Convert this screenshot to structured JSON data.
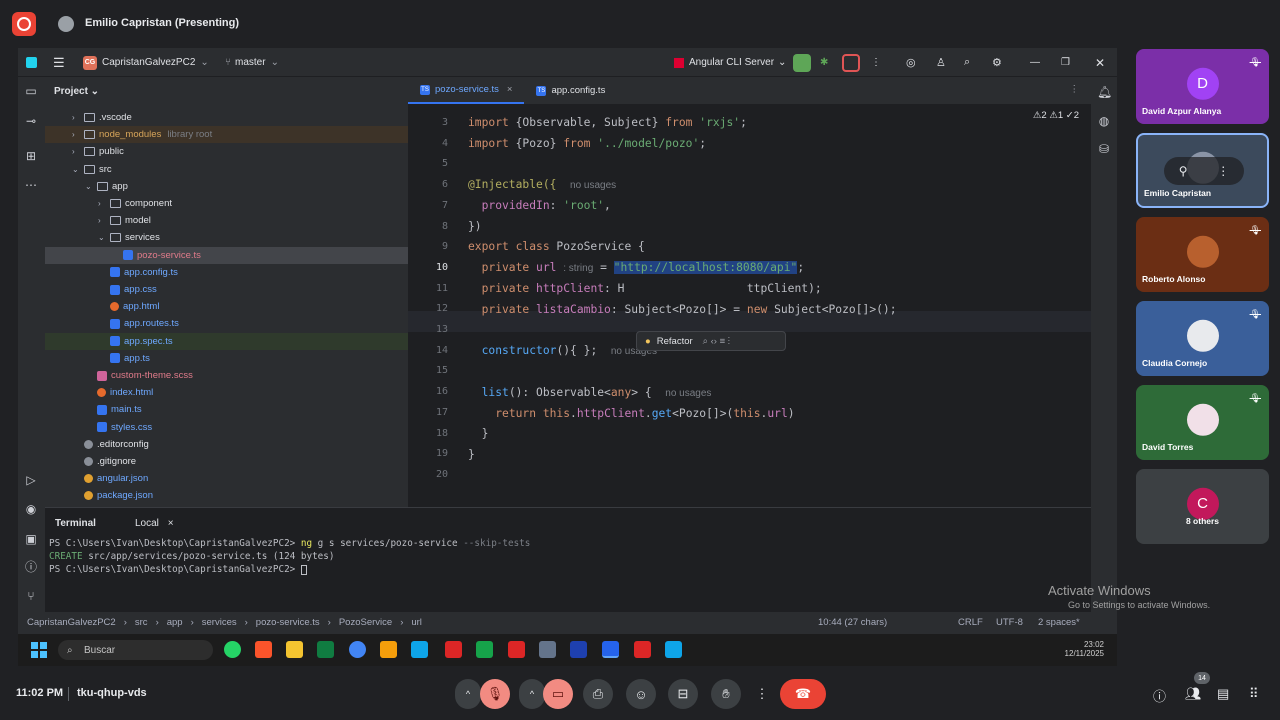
{
  "meeting": {
    "presenter_title": "Emilio Capristan (Presenting)",
    "time": "11:02 PM",
    "meeting_code": "tku-qhup-vds",
    "participant_count": "14"
  },
  "ide": {
    "project_badge": "CG",
    "project_name": "CapristanGalvezPC2",
    "branch": "master",
    "run_config": "Angular CLI Server",
    "project_panel_title": "Project",
    "tree": [
      {
        "label": ".vscode",
        "depth": 1,
        "type": "folder",
        "arrow": "›"
      },
      {
        "label": "node_modules",
        "depth": 1,
        "type": "folder",
        "arrow": "›",
        "note": "library root"
      },
      {
        "label": "public",
        "depth": 1,
        "type": "folder",
        "arrow": "›"
      },
      {
        "label": "src",
        "depth": 1,
        "type": "folder",
        "arrow": "⌄"
      },
      {
        "label": "app",
        "depth": 2,
        "type": "folder",
        "arrow": "⌄"
      },
      {
        "label": "component",
        "depth": 3,
        "type": "folder",
        "arrow": "›"
      },
      {
        "label": "model",
        "depth": 3,
        "type": "folder",
        "arrow": "›"
      },
      {
        "label": "services",
        "depth": 3,
        "type": "folder",
        "arrow": "⌄"
      },
      {
        "label": "pozo-service.ts",
        "depth": 4,
        "type": "ts",
        "selected": true
      },
      {
        "label": "app.config.ts",
        "depth": 3,
        "type": "ts"
      },
      {
        "label": "app.css",
        "depth": 3,
        "type": "css"
      },
      {
        "label": "app.html",
        "depth": 3,
        "type": "html"
      },
      {
        "label": "app.routes.ts",
        "depth": 3,
        "type": "ts"
      },
      {
        "label": "app.spec.ts",
        "depth": 3,
        "type": "ts",
        "highlight": true
      },
      {
        "label": "app.ts",
        "depth": 3,
        "type": "ts"
      },
      {
        "label": "custom-theme.scss",
        "depth": 2,
        "type": "scss"
      },
      {
        "label": "index.html",
        "depth": 2,
        "type": "html"
      },
      {
        "label": "main.ts",
        "depth": 2,
        "type": "ts"
      },
      {
        "label": "styles.css",
        "depth": 2,
        "type": "css"
      },
      {
        "label": ".editorconfig",
        "depth": 1,
        "type": "config"
      },
      {
        "label": ".gitignore",
        "depth": 1,
        "type": "config"
      },
      {
        "label": "angular.json",
        "depth": 1,
        "type": "json"
      },
      {
        "label": "package.json",
        "depth": 1,
        "type": "json"
      }
    ],
    "tabs": [
      {
        "label": "pozo-service.ts",
        "active": true
      },
      {
        "label": "app.config.ts",
        "active": false
      }
    ],
    "inspections": "⚠2  ⚠1  ✓2",
    "line_numbers": [
      "3",
      "4",
      "5",
      "6",
      "7",
      "8",
      "9",
      "10",
      "11",
      "12",
      "13",
      "14",
      "15",
      "16",
      "17",
      "18",
      "19",
      "20"
    ],
    "code": {
      "l3": "import {Observable, Subject} from 'rxjs';",
      "l4": "import {Pozo} from '../model/pozo';",
      "l6_ann": "@Injectable({",
      "l6_hint": "no usages",
      "l7": "  providedIn: 'root',",
      "l8": "})",
      "l9": "export class PozoService {",
      "l10_a": "  private url",
      "l10_hint": ": string",
      "l10_b": " = ",
      "l10_str": "\"http://localhost:8080/api\"",
      "l10_c": ";",
      "l11_a": "  private httpClient: H",
      "l11_b": "ttpClient);",
      "l12": "  private listaCambio: Subject<Pozo[]> = new Subject<Pozo[]>();",
      "l14": "  constructor(){ };",
      "l14_hint": "no usages",
      "l16": "  list(): Observable<any> {",
      "l16_hint": "no usages",
      "l17": "    return this.httpClient.get<Pozo[]>(this.url)",
      "l18": "  }",
      "l19": "}"
    },
    "popup_label": "Refactor",
    "terminal": {
      "title": "Terminal",
      "tab": "Local",
      "lines": [
        "PS C:\\Users\\Ivan\\Desktop\\CapristanGalvezPC2> ng g s services/pozo-service --skip-tests",
        "CREATE src/app/services/pozo-service.ts (124 bytes)",
        "PS C:\\Users\\Ivan\\Desktop\\CapristanGalvezPC2> "
      ]
    },
    "breadcrumb": [
      "CapristanGalvezPC2",
      "src",
      "app",
      "services",
      "pozo-service.ts",
      "PozoService",
      "url"
    ],
    "status": {
      "position": "10:44 (27 chars)",
      "line_sep": "CRLF",
      "encoding": "UTF-8",
      "indent": "2 spaces*"
    }
  },
  "taskbar": {
    "search_placeholder": "Buscar",
    "activate_title": "Activate Windows",
    "activate_sub": "Go to Settings to activate Windows.",
    "clock_time": "23:02",
    "clock_date": "12/11/2025"
  },
  "participants": [
    {
      "name": "David Azpur Alanya",
      "initial": "D",
      "bg": "#7b2fa8",
      "avbg": "#a142f4",
      "muted": true
    },
    {
      "name": "Emilio Capristan",
      "initial": "",
      "bg": "#3c4a5c",
      "avbg": "#8a94a6",
      "muted": false,
      "active": true
    },
    {
      "name": "Roberto Alonso",
      "initial": "",
      "bg": "#6b2e14",
      "avbg": "#b8602e",
      "muted": true
    },
    {
      "name": "Claudia Cornejo",
      "initial": "",
      "bg": "#3a5f9a",
      "avbg": "#e8eaed",
      "muted": true
    },
    {
      "name": "David Torres",
      "initial": "",
      "bg": "#2e6b38",
      "avbg": "#f1e0e8",
      "muted": true
    },
    {
      "name": "8 others",
      "initial": "C",
      "bg": "#3c4043",
      "avbg": "#c2185b",
      "muted": false
    }
  ]
}
